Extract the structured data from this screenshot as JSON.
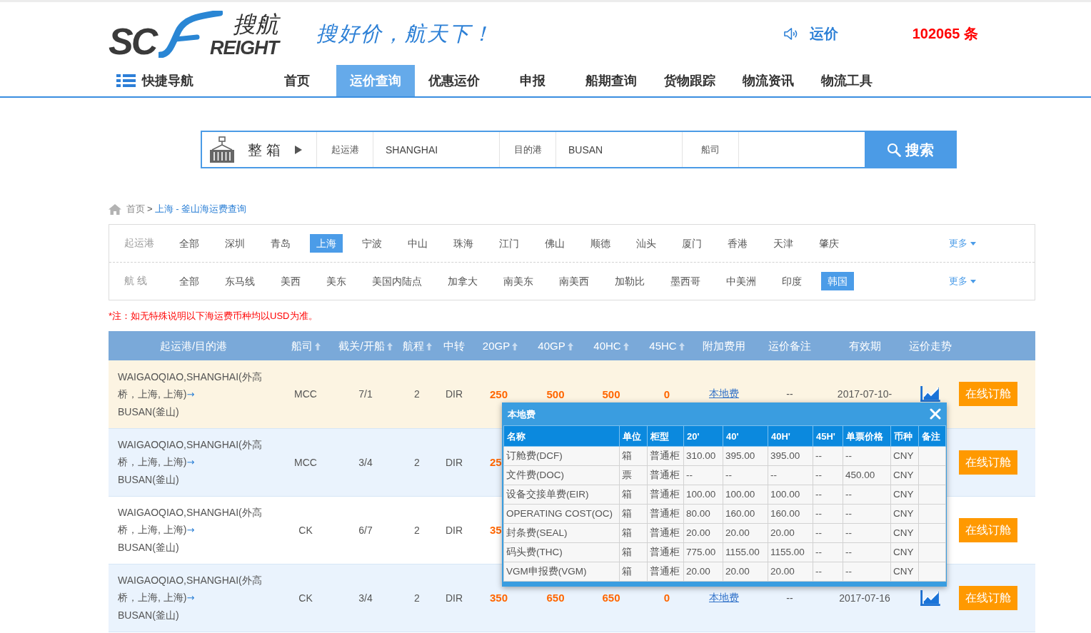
{
  "header": {
    "logo": {
      "mark": "SC",
      "name_cn": "搜航",
      "name_en": "REIGHT"
    },
    "slogan": "搜好价，航天下！",
    "ticker": {
      "label": "运价",
      "count": "102065 条"
    }
  },
  "nav": {
    "quick_nav": "快捷导航",
    "items": [
      {
        "label": "首页",
        "selected": false
      },
      {
        "label": "运价查询",
        "selected": true
      },
      {
        "label": "优惠运价",
        "selected": false
      },
      {
        "label": "申报",
        "selected": false
      },
      {
        "label": "船期查询",
        "selected": false
      },
      {
        "label": "货物跟踪",
        "selected": false
      },
      {
        "label": "物流资讯",
        "selected": false
      },
      {
        "label": "物流工具",
        "selected": false
      }
    ]
  },
  "search": {
    "mode": "整 箱",
    "fields": [
      {
        "label": "起运港",
        "value": "SHANGHAI"
      },
      {
        "label": "目的港",
        "value": "BUSAN"
      },
      {
        "label": "船司"
      }
    ],
    "button": "搜索"
  },
  "breadcrumb": {
    "home": "首页",
    "separator": ">",
    "current": "上海 - 釜山海运费查询"
  },
  "filters": [
    {
      "label": "起运港",
      "options": [
        {
          "label": "全部",
          "selected": false
        },
        {
          "label": "深圳",
          "selected": false
        },
        {
          "label": "青岛",
          "selected": false
        },
        {
          "label": "上海",
          "selected": true
        },
        {
          "label": "宁波",
          "selected": false
        },
        {
          "label": "中山",
          "selected": false
        },
        {
          "label": "珠海",
          "selected": false
        },
        {
          "label": "江门",
          "selected": false
        },
        {
          "label": "佛山",
          "selected": false
        },
        {
          "label": "顺德",
          "selected": false
        },
        {
          "label": "汕头",
          "selected": false
        },
        {
          "label": "厦门",
          "selected": false
        },
        {
          "label": "香港",
          "selected": false
        },
        {
          "label": "天津",
          "selected": false
        },
        {
          "label": "肇庆",
          "selected": false
        }
      ],
      "more": "更多"
    },
    {
      "label": "航 线",
      "options": [
        {
          "label": "全部",
          "selected": false
        },
        {
          "label": "东马线",
          "selected": false
        },
        {
          "label": "美西",
          "selected": false
        },
        {
          "label": "美东",
          "selected": false
        },
        {
          "label": "美国内陆点",
          "selected": false
        },
        {
          "label": "加拿大",
          "selected": false
        },
        {
          "label": "南美东",
          "selected": false
        },
        {
          "label": "南美西",
          "selected": false
        },
        {
          "label": "加勒比",
          "selected": false
        },
        {
          "label": "墨西哥",
          "selected": false
        },
        {
          "label": "中美洲",
          "selected": false
        },
        {
          "label": "印度",
          "selected": false
        },
        {
          "label": "韩国",
          "selected": true
        }
      ],
      "more": "更多"
    }
  ],
  "note": "*注：如无特殊说明以下海运费币种均以USD为准。",
  "rates_table": {
    "columns": [
      {
        "label": "起运港/目的港",
        "sortable": false
      },
      {
        "label": "船司",
        "sortable": true
      },
      {
        "label": "截关/开船",
        "sortable": true
      },
      {
        "label": "航程",
        "sortable": true
      },
      {
        "label": "中转",
        "sortable": false
      },
      {
        "label": "20GP",
        "sortable": true
      },
      {
        "label": "40GP",
        "sortable": true
      },
      {
        "label": "40HC",
        "sortable": true
      },
      {
        "label": "45HC",
        "sortable": true
      },
      {
        "label": "附加费用",
        "sortable": false
      },
      {
        "label": "运价备注",
        "sortable": false
      },
      {
        "label": "有效期",
        "sortable": false
      },
      {
        "label": "运价走势",
        "sortable": false
      }
    ],
    "rows": [
      {
        "highlighted": true,
        "route": {
          "origin": "WAIGAOQIAO,SHANGHAI(外高桥，上海, 上海)",
          "arrow": "→",
          "destination": "BUSAN(釜山)"
        },
        "carrier": "MCC",
        "cutoff_sailing": "7/1",
        "transit": "2",
        "transship": "DIR",
        "rate_20gp": "250",
        "rate_40gp": "500",
        "rate_40hc": "500",
        "rate_45hc": "0",
        "surcharge": "本地费",
        "remark": "--",
        "validity": "2017-07-10-",
        "trend_chart": true,
        "book": "在线订舱"
      },
      {
        "highlighted": false,
        "route": {
          "origin": "WAIGAOQIAO,SHANGHAI(外高桥，上海, 上海)",
          "arrow": "→",
          "destination": "BUSAN(釜山)"
        },
        "carrier": "MCC",
        "cutoff_sailing": "3/4",
        "transit": "2",
        "transship": "DIR",
        "rate_20gp": "25",
        "book": "在线订舱"
      },
      {
        "highlighted": false,
        "route": {
          "origin": "WAIGAOQIAO,SHANGHAI(外高桥，上海, 上海)",
          "arrow": "→",
          "destination": "BUSAN(釜山)"
        },
        "carrier": "CK",
        "cutoff_sailing": "6/7",
        "transit": "2",
        "transship": "DIR",
        "rate_20gp": "35",
        "book": "在线订舱"
      },
      {
        "highlighted": false,
        "route": {
          "origin": "WAIGAOQIAO,SHANGHAI(外高桥，上海, 上海)",
          "arrow": "→",
          "destination": "BUSAN(釜山)"
        },
        "carrier": "CK",
        "cutoff_sailing": "3/4",
        "transit": "2",
        "transship": "DIR",
        "rate_20gp": "350",
        "rate_40gp": "650",
        "rate_40hc": "650",
        "rate_45hc": "0",
        "surcharge": "本地费",
        "remark": "--",
        "validity": "2017-07-16",
        "trend_chart": true,
        "book": "在线订舱"
      }
    ]
  },
  "fee_popup": {
    "title": "本地费",
    "columns": [
      "名称",
      "单位",
      "柜型",
      "20'",
      "40'",
      "40H'",
      "45H'",
      "单票价格",
      "币种",
      "备注"
    ],
    "rows": [
      [
        "订舱费(DCF)",
        "箱",
        "普通柜",
        "310.00",
        "395.00",
        "395.00",
        "--",
        "--",
        "CNY"
      ],
      [
        "文件费(DOC)",
        "票",
        "普通柜",
        "--",
        "--",
        "--",
        "--",
        "450.00",
        "CNY"
      ],
      [
        "设备交接单费(EIR)",
        "箱",
        "普通柜",
        "100.00",
        "100.00",
        "100.00",
        "--",
        "--",
        "CNY"
      ],
      [
        "OPERATING COST(OC)",
        "箱",
        "普通柜",
        "80.00",
        "160.00",
        "160.00",
        "--",
        "--",
        "CNY"
      ],
      [
        "封条费(SEAL)",
        "箱",
        "普通柜",
        "20.00",
        "20.00",
        "20.00",
        "--",
        "--",
        "CNY"
      ],
      [
        "码头费(THC)",
        "箱",
        "普通柜",
        "775.00",
        "1155.00",
        "1155.00",
        "--",
        "--",
        "CNY"
      ],
      [
        "VGM申报费(VGM)",
        "箱",
        "普通柜",
        "20.00",
        "20.00",
        "20.00",
        "--",
        "--",
        "CNY"
      ]
    ]
  }
}
